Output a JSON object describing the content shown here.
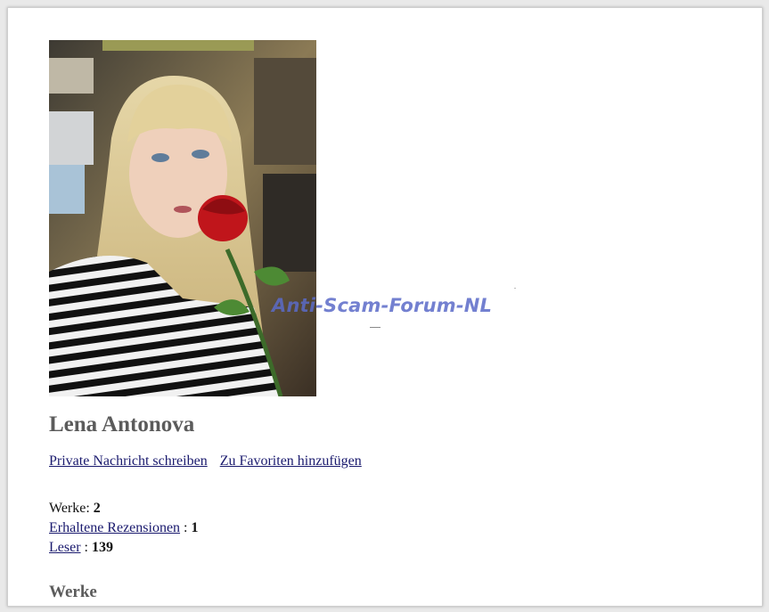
{
  "profile": {
    "photo_alt": "Lena Antonova",
    "name": "Lena Antonova"
  },
  "actions": {
    "private_message": "Private Nachricht schreiben",
    "add_favorite": "Zu Favoriten hinzufügen"
  },
  "stats": {
    "works_label": "Werke:",
    "works_value": "2",
    "reviews_label": "Erhaltene Rezensionen",
    "reviews_value": "1",
    "readers_label": "Leser",
    "readers_value": "139",
    "separator": ":"
  },
  "sections": {
    "works_title": "Werke"
  },
  "watermark": {
    "text": "Anti-Scam-Forum-NL"
  },
  "colors": {
    "link": "#1a1a6e",
    "heading": "#5b5b5b",
    "watermark": "#5b6bc8"
  }
}
